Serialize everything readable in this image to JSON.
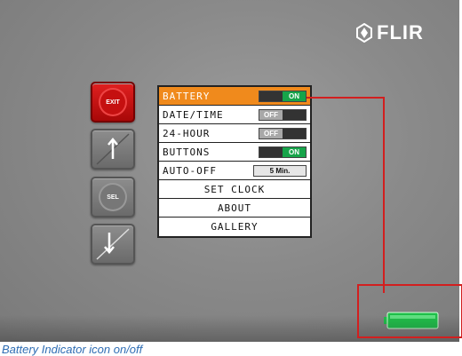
{
  "brand": {
    "logo_text": "FLIR"
  },
  "buttons": {
    "exit_label": "EXIT",
    "sel_label": "SEL",
    "up_icon": "arrow-up-icon",
    "down_icon": "arrow-down-icon"
  },
  "menu": {
    "items": [
      {
        "label": "BATTERY",
        "control": "toggle",
        "value": "ON",
        "selected": true
      },
      {
        "label": "DATE/TIME",
        "control": "toggle",
        "value": "OFF"
      },
      {
        "label": "24-HOUR",
        "control": "toggle",
        "value": "OFF"
      },
      {
        "label": "BUTTONS",
        "control": "toggle",
        "value": "ON"
      },
      {
        "label": "AUTO-OFF",
        "control": "value",
        "value": "5 Min."
      },
      {
        "label": "SET CLOCK"
      },
      {
        "label": "ABOUT"
      },
      {
        "label": "GALLERY"
      }
    ]
  },
  "indicator": {
    "icon": "battery-icon",
    "color": "#1fbf4a"
  },
  "caption": "Battery Indicator icon on/off",
  "colors": {
    "selected_row": "#f08a1c",
    "on_green": "#17a44a",
    "exit_red": "#d01414",
    "callout": "#d21f1f"
  }
}
